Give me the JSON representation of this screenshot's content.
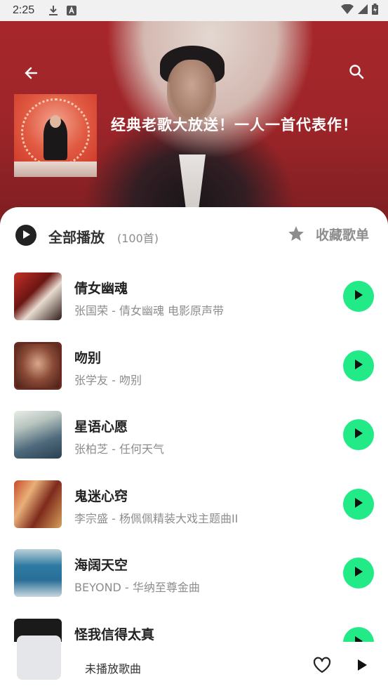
{
  "status_bar": {
    "time": "2:25",
    "icons": [
      "download-icon",
      "a-icon",
      "wifi-icon",
      "signal-icon",
      "battery-icon"
    ]
  },
  "header": {
    "playlist_title": "经典老歌大放送！一人一首代表作！",
    "back_icon": "arrow-left-icon",
    "search_icon": "search-icon"
  },
  "controls": {
    "play_all_label": "全部播放",
    "track_count": "(100首)",
    "collect_label": "收藏歌单"
  },
  "songs": [
    {
      "title": "倩女幽魂",
      "subtitle": "张国荣 - 倩女幽魂 电影原声带"
    },
    {
      "title": "吻别",
      "subtitle": "张学友 - 吻别"
    },
    {
      "title": "星语心愿",
      "subtitle": "张柏芝 - 任何天气"
    },
    {
      "title": "鬼迷心窍",
      "subtitle": "李宗盛 - 杨佩佩精装大戏主题曲II"
    },
    {
      "title": "海阔天空",
      "subtitle": "BEYOND - 华纳至尊金曲"
    },
    {
      "title": "怪我信得太真",
      "subtitle": ""
    }
  ],
  "mini_player": {
    "label": "未播放歌曲"
  },
  "colors": {
    "accent": "#22ea86",
    "header_red": "#a7262b"
  }
}
